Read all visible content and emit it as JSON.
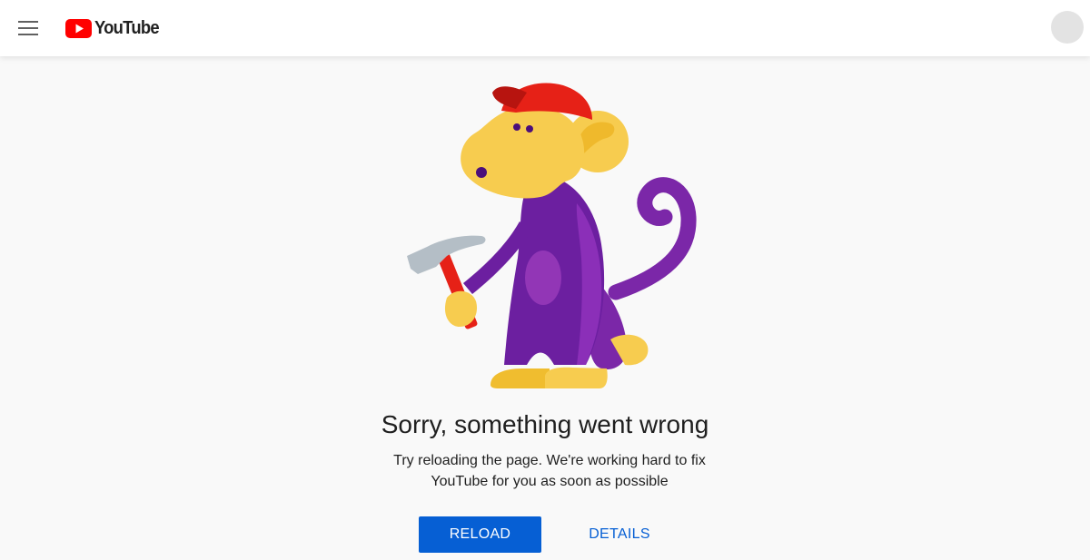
{
  "header": {
    "logo_text": "YouTube",
    "menu_icon": "hamburger-menu-icon",
    "logo_icon": "youtube-play-icon",
    "brand_color": "#ff0000"
  },
  "error": {
    "title": "Sorry, something went wrong",
    "message": "Try reloading the page. We're working hard to fix YouTube for you as soon as possible",
    "illustration": "monkey-with-hammer"
  },
  "actions": {
    "reload_label": "RELOAD",
    "details_label": "DETAILS"
  },
  "colors": {
    "accent": "#065fd4",
    "background": "#f9f9f9",
    "monkey_purple": "#6c1fa0",
    "monkey_yellow": "#f7cc4f",
    "cap_red": "#e62117"
  }
}
